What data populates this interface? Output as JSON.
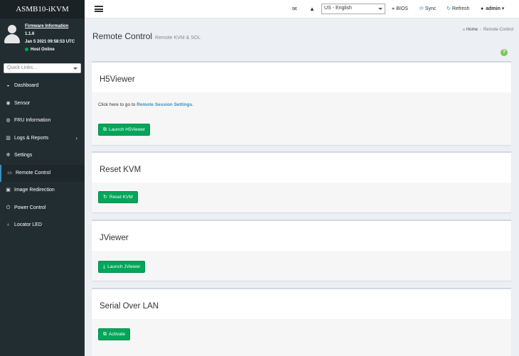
{
  "brand": "ASMB10-iKVM",
  "user": {
    "firmware_label": "Firmware Information",
    "version": "1.1.6",
    "datetime": "Jan 5 2021 09:58:53 UTC",
    "status": "Host Online"
  },
  "quick_links": {
    "placeholder": "Quick Links..."
  },
  "menu": [
    {
      "label": "Dashboard",
      "icon": "dashboard-icon"
    },
    {
      "label": "Sensor",
      "icon": "sensor-icon"
    },
    {
      "label": "FRU Information",
      "icon": "fru-icon"
    },
    {
      "label": "Logs & Reports",
      "icon": "chart-icon"
    },
    {
      "label": "Settings",
      "icon": "gear-icon"
    },
    {
      "label": "Remote Control",
      "icon": "monitor-icon"
    },
    {
      "label": "Image Redirection",
      "icon": "image-icon"
    },
    {
      "label": "Power Control",
      "icon": "power-icon"
    },
    {
      "label": "Locator LED",
      "icon": "bulb-icon"
    }
  ],
  "header": {
    "language": "US - English",
    "bios": "BIOS",
    "sync": "Sync",
    "refresh": "Refresh",
    "user": "admin"
  },
  "page": {
    "title": "Remote Control",
    "subtitle": "Remote KVM & SOL",
    "breadcrumb_home": "Home",
    "breadcrumb_current": "Remote Control"
  },
  "sections": {
    "h5viewer": {
      "title": "H5Viewer",
      "desc_prefix": "Click here to go to ",
      "desc_link": "Remote Session Settings",
      "desc_suffix": ".",
      "button": "Launch H5Viewer"
    },
    "reset_kvm": {
      "title": "Reset KVM",
      "button": "Reset KVM"
    },
    "jviewer": {
      "title": "JViewer",
      "button": "Launch JViewer"
    },
    "sol": {
      "title": "Serial Over LAN",
      "button": "Activate"
    }
  },
  "colors": {
    "accent": "#00a65a",
    "sidebar": "#222d32",
    "link": "#3c8dbc"
  }
}
